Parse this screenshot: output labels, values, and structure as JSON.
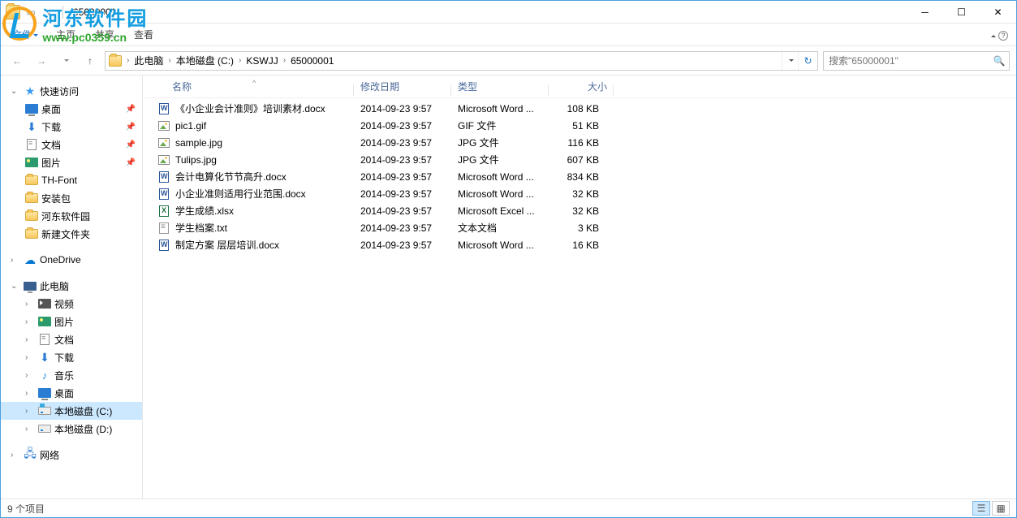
{
  "window": {
    "title": "65000001"
  },
  "ribbon": {
    "file": "文件",
    "tabs": [
      "主页",
      "共享",
      "查看"
    ]
  },
  "breadcrumb": {
    "items": [
      "此电脑",
      "本地磁盘 (C:)",
      "KSWJJ",
      "65000001"
    ]
  },
  "search": {
    "placeholder": "搜索\"65000001\""
  },
  "sidebar": {
    "quickaccess": {
      "label": "快速访问"
    },
    "qa_items": [
      {
        "label": "桌面",
        "icon": "desktop",
        "pinned": true
      },
      {
        "label": "下载",
        "icon": "download",
        "pinned": true
      },
      {
        "label": "文档",
        "icon": "doc",
        "pinned": true
      },
      {
        "label": "图片",
        "icon": "pic",
        "pinned": true
      },
      {
        "label": "TH-Font",
        "icon": "folder",
        "pinned": false
      },
      {
        "label": "安装包",
        "icon": "folder",
        "pinned": false
      },
      {
        "label": "河东软件园",
        "icon": "folder",
        "pinned": false
      },
      {
        "label": "新建文件夹",
        "icon": "folder",
        "pinned": false
      }
    ],
    "onedrive": {
      "label": "OneDrive"
    },
    "thispc": {
      "label": "此电脑"
    },
    "pc_items": [
      {
        "label": "视频",
        "icon": "video"
      },
      {
        "label": "图片",
        "icon": "pic"
      },
      {
        "label": "文档",
        "icon": "doc"
      },
      {
        "label": "下载",
        "icon": "download"
      },
      {
        "label": "音乐",
        "icon": "music"
      },
      {
        "label": "桌面",
        "icon": "desktop"
      },
      {
        "label": "本地磁盘 (C:)",
        "icon": "drive-sys",
        "selected": true
      },
      {
        "label": "本地磁盘 (D:)",
        "icon": "drive"
      }
    ],
    "network": {
      "label": "网络"
    }
  },
  "columns": {
    "name": "名称",
    "date": "修改日期",
    "type": "类型",
    "size": "大小"
  },
  "files": [
    {
      "name": "《小企业会计准则》培训素材.docx",
      "date": "2014-09-23 9:57",
      "type": "Microsoft Word ...",
      "size": "108 KB",
      "icon": "docx"
    },
    {
      "name": "pic1.gif",
      "date": "2014-09-23 9:57",
      "type": "GIF 文件",
      "size": "51 KB",
      "icon": "img"
    },
    {
      "name": "sample.jpg",
      "date": "2014-09-23 9:57",
      "type": "JPG 文件",
      "size": "116 KB",
      "icon": "img"
    },
    {
      "name": "Tulips.jpg",
      "date": "2014-09-23 9:57",
      "type": "JPG 文件",
      "size": "607 KB",
      "icon": "img"
    },
    {
      "name": "会计电算化节节高升.docx",
      "date": "2014-09-23 9:57",
      "type": "Microsoft Word ...",
      "size": "834 KB",
      "icon": "docx"
    },
    {
      "name": "小企业准则适用行业范围.docx",
      "date": "2014-09-23 9:57",
      "type": "Microsoft Word ...",
      "size": "32 KB",
      "icon": "docx"
    },
    {
      "name": "学生成绩.xlsx",
      "date": "2014-09-23 9:57",
      "type": "Microsoft Excel ...",
      "size": "32 KB",
      "icon": "xlsx"
    },
    {
      "name": "学生档案.txt",
      "date": "2014-09-23 9:57",
      "type": "文本文档",
      "size": "3 KB",
      "icon": "txt"
    },
    {
      "name": "制定方案 层层培训.docx",
      "date": "2014-09-23 9:57",
      "type": "Microsoft Word ...",
      "size": "16 KB",
      "icon": "docx"
    }
  ],
  "statusbar": {
    "count": "9 个项目"
  },
  "watermark": {
    "cn": "河东软件园",
    "url": "www.pc0359.cn"
  }
}
